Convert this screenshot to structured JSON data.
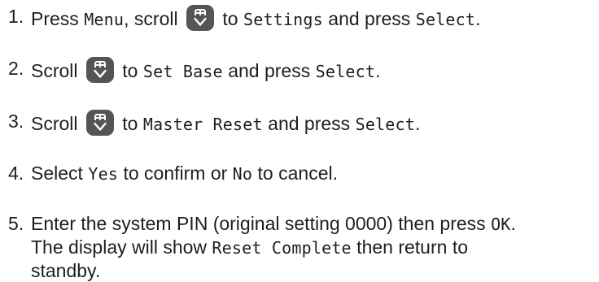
{
  "steps": [
    {
      "number": "1.",
      "parts": [
        {
          "t": "Press "
        },
        {
          "t": "Menu",
          "lcd": true
        },
        {
          "t": ", scroll "
        },
        {
          "icon": "scroll-key-icon"
        },
        {
          "t": " to "
        },
        {
          "t": "Settings",
          "lcd": true
        },
        {
          "t": " and press "
        },
        {
          "t": "Select",
          "lcd": true
        },
        {
          "t": "."
        }
      ]
    },
    {
      "number": "2.",
      "parts": [
        {
          "t": "Scroll "
        },
        {
          "icon": "scroll-key-icon"
        },
        {
          "t": " to "
        },
        {
          "t": "Set Base",
          "lcd": true
        },
        {
          "t": " and press "
        },
        {
          "t": "Select",
          "lcd": true
        },
        {
          "t": "."
        }
      ]
    },
    {
      "number": "3.",
      "parts": [
        {
          "t": "Scroll "
        },
        {
          "icon": "scroll-key-icon"
        },
        {
          "t": " to "
        },
        {
          "t": "Master Reset",
          "lcd": true
        },
        {
          "t": " and press "
        },
        {
          "t": "Select",
          "lcd": true
        },
        {
          "t": "."
        }
      ]
    },
    {
      "number": "4.",
      "parts": [
        {
          "t": "Select "
        },
        {
          "t": "Yes",
          "lcd": true
        },
        {
          "t": " to confirm or "
        },
        {
          "t": "No",
          "lcd": true
        },
        {
          "t": " to cancel."
        }
      ]
    },
    {
      "number": "5.",
      "parts": [
        {
          "t": "Enter the system PIN (original setting 0000) then press "
        },
        {
          "t": "OK",
          "lcd": true
        },
        {
          "t": "."
        },
        {
          "br": true
        },
        {
          "t": "The display will show "
        },
        {
          "t": "Reset Complete",
          "lcd": true
        },
        {
          "t": " then return to"
        },
        {
          "br": true
        },
        {
          "t": "standby."
        }
      ]
    }
  ],
  "colors": {
    "text": "#1e1e1e",
    "key_fill": "#555555",
    "key_symbol": "#ffffff"
  }
}
